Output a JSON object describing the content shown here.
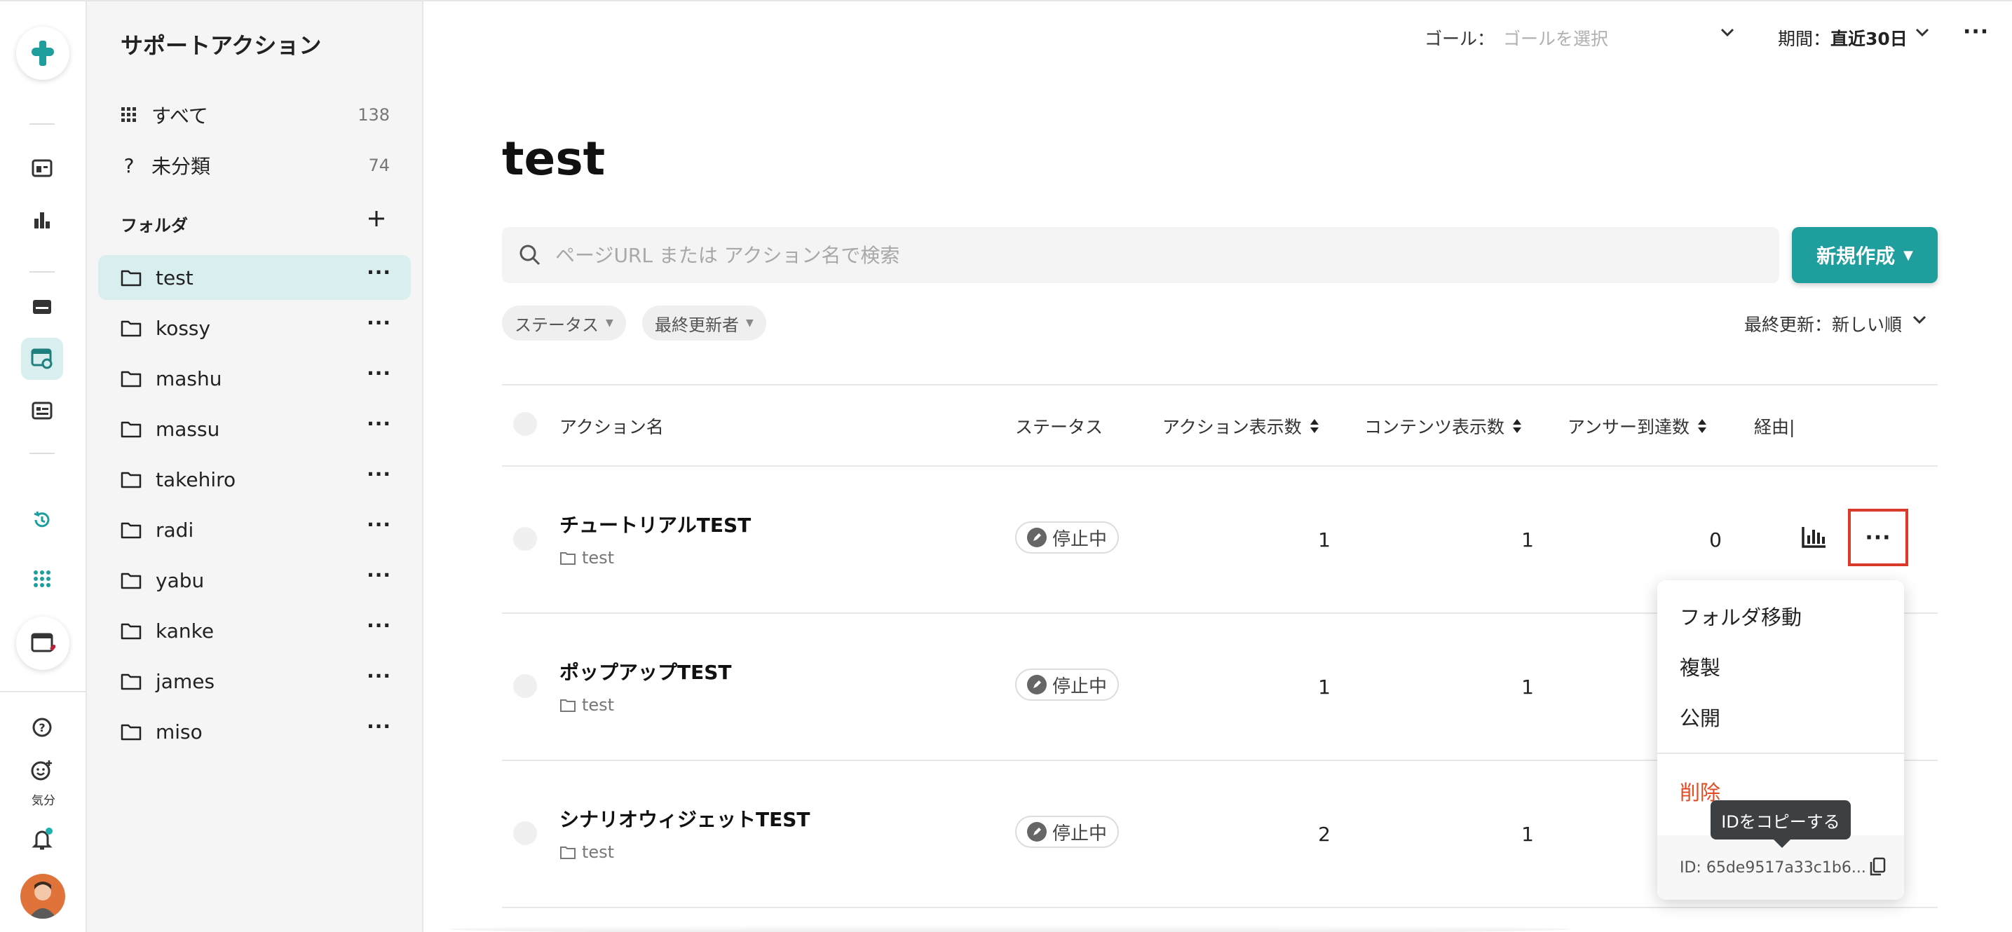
{
  "rail": {
    "mood_label": "気分"
  },
  "sidebar": {
    "title": "サポートアクション",
    "all": {
      "label": "すべて",
      "count": "138"
    },
    "uncategorized": {
      "label": "未分類",
      "count": "74"
    },
    "folders_label": "フォルダ",
    "folders": [
      "test",
      "kossy",
      "mashu",
      "massu",
      "takehiro",
      "radi",
      "yabu",
      "kanke",
      "james",
      "miso"
    ]
  },
  "topbar": {
    "goal_label": "ゴール：",
    "goal_placeholder": "ゴールを選択",
    "period_prefix": "期間：",
    "period_value": "直近30日"
  },
  "main": {
    "title": "test",
    "search_placeholder": "ページURL または アクション名で検索",
    "new_button": "新規作成",
    "filters": [
      "ステータス",
      "最終更新者"
    ],
    "sort_label": "最終更新：新しい順"
  },
  "table": {
    "headers": {
      "name": "アクション名",
      "status": "ステータス",
      "action_views": "アクション表示数",
      "content_views": "コンテンツ表示数",
      "answer_reached": "アンサー到達数",
      "via": "経由|"
    },
    "rows": [
      {
        "name": "チュートリアルTEST",
        "folder": "test",
        "status": "停止中",
        "action_views": "1",
        "content_views": "1",
        "answer_reached": "0"
      },
      {
        "name": "ポップアップTEST",
        "folder": "test",
        "status": "停止中",
        "action_views": "1",
        "content_views": "1",
        "answer_reached": ""
      },
      {
        "name": "シナリオウィジェットTEST",
        "folder": "test",
        "status": "停止中",
        "action_views": "2",
        "content_views": "1",
        "answer_reached": ""
      }
    ]
  },
  "menu": {
    "items": [
      "フォルダ移動",
      "複製",
      "公開"
    ],
    "delete": "削除",
    "id_text": "ID: 65de9517a33c1b6...",
    "tooltip": "IDをコピーする"
  },
  "colors": {
    "accent": "#1f9e9e",
    "active_bg": "#d9eeee",
    "danger": "#e24a22",
    "highlight_border": "#d93a2a"
  }
}
